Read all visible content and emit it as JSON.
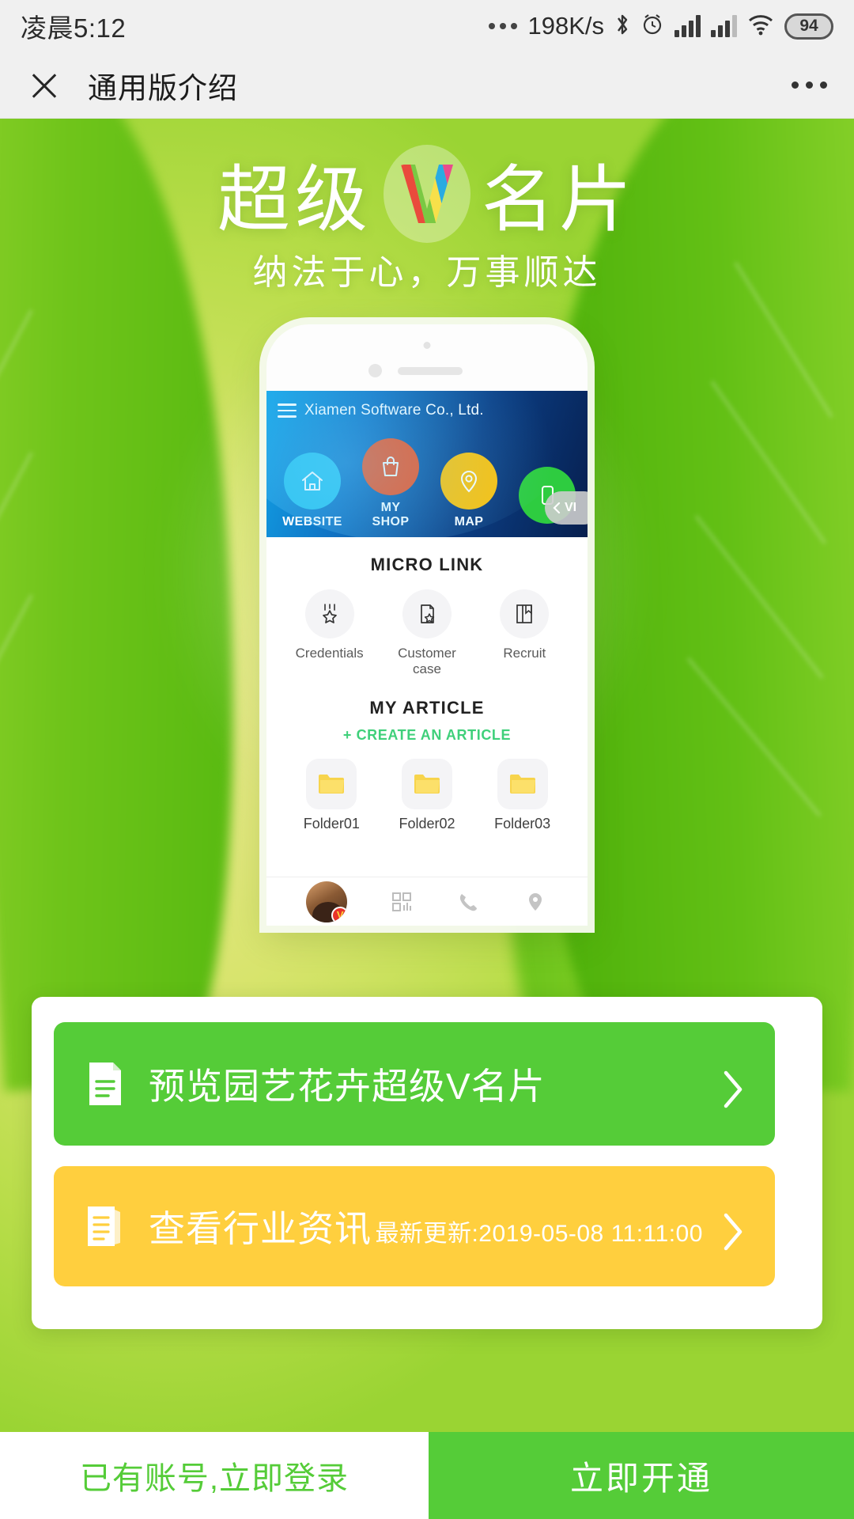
{
  "status_bar": {
    "time": "凌晨5:12",
    "network_speed": "198K/s",
    "battery": "94",
    "icons": [
      "more-dots-icon",
      "bluetooth-icon",
      "alarm-icon",
      "signal-icon",
      "signal-icon",
      "wifi-icon",
      "battery-icon"
    ]
  },
  "nav_bar": {
    "close_icon": "close-icon",
    "title": "通用版介绍",
    "more_icon": "more-icon"
  },
  "hero": {
    "title_left": "超级",
    "title_right": "名片",
    "logo_letter": "V",
    "subtitle": "纳法于心，万事顺达"
  },
  "phone_preview": {
    "company": "Xiamen Software Co., Ltd.",
    "menu_icon": "hamburger-icon",
    "nav_icons": [
      {
        "label": "WEBSITE",
        "icon": "home-icon",
        "color": "#29c3ef"
      },
      {
        "label": "MY SHOP",
        "icon": "shop-bag-icon",
        "color": "#f4511e"
      },
      {
        "label": "MAP",
        "icon": "map-pin-icon",
        "color": "#ffc107"
      },
      {
        "label": "",
        "icon": "phone-icon",
        "color": "#2ecc40"
      }
    ],
    "pill_label": "VI",
    "micro_link": {
      "title": "MICRO LINK",
      "items": [
        {
          "label": "Credentials",
          "icon": "medal-star-icon"
        },
        {
          "label": "Customer case",
          "icon": "document-star-icon"
        },
        {
          "label": "Recruit",
          "icon": "book-icon"
        }
      ]
    },
    "my_article": {
      "title": "MY ARTICLE",
      "create_label": "+ CREATE AN ARTICLE",
      "folders": [
        {
          "label": "Folder01",
          "icon": "folder-icon"
        },
        {
          "label": "Folder02",
          "icon": "folder-icon"
        },
        {
          "label": "Folder03",
          "icon": "folder-icon"
        }
      ]
    },
    "bottom_nav": [
      {
        "icon": "avatar-icon",
        "badge": "V"
      },
      {
        "icon": "qrcode-icon",
        "badge": ""
      },
      {
        "icon": "phone-icon",
        "badge": ""
      },
      {
        "icon": "location-icon",
        "badge": ""
      }
    ]
  },
  "card": {
    "preview_button": {
      "icon": "document-icon",
      "label": "预览园艺花卉超级V名片",
      "chevron": "chevron-right-icon"
    },
    "news_button": {
      "icon": "news-document-icon",
      "label": "查看行业资讯",
      "sublabel": "最新更新:2019-05-08 11:11:00",
      "chevron": "chevron-right-icon"
    }
  },
  "bottom_bar": {
    "login_label": "已有账号,立即登录",
    "open_label": "立即开通"
  },
  "colors": {
    "green": "#55CC38",
    "yellow": "#FFCF3E",
    "create_link_green": "#3FD07A",
    "header_bg": "#F0F0F0"
  }
}
